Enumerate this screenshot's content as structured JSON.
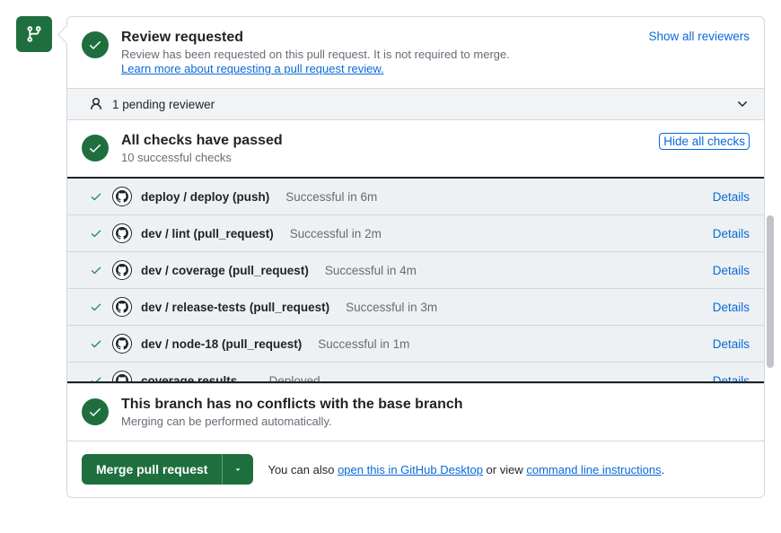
{
  "review": {
    "title": "Review requested",
    "subtitle": "Review has been requested on this pull request. It is not required to merge.",
    "learn_more": "Learn more about requesting a pull request review.",
    "show_all": "Show all reviewers",
    "pending": "1 pending reviewer"
  },
  "checks": {
    "title": "All checks have passed",
    "subtitle": "10 successful checks",
    "hide_all": "Hide all checks",
    "details_label": "Details",
    "rows": [
      {
        "name": "deploy / deploy (push)",
        "status": "Successful in 6m",
        "sep": ""
      },
      {
        "name": "dev / lint (pull_request)",
        "status": "Successful in 2m",
        "sep": ""
      },
      {
        "name": "dev / coverage (pull_request)",
        "status": "Successful in 4m",
        "sep": ""
      },
      {
        "name": "dev / release-tests (pull_request)",
        "status": "Successful in 3m",
        "sep": ""
      },
      {
        "name": "dev / node-18 (pull_request)",
        "status": "Successful in 1m",
        "sep": ""
      },
      {
        "name": "coverage results",
        "status": "Deployed",
        "sep": " — "
      }
    ]
  },
  "conflicts": {
    "title": "This branch has no conflicts with the base branch",
    "subtitle": "Merging can be performed automatically."
  },
  "merge": {
    "button": "Merge pull request",
    "text_pre": "You can also ",
    "desktop": "open this in GitHub Desktop",
    "text_mid": " or view ",
    "cli": "command line instructions",
    "text_post": "."
  }
}
